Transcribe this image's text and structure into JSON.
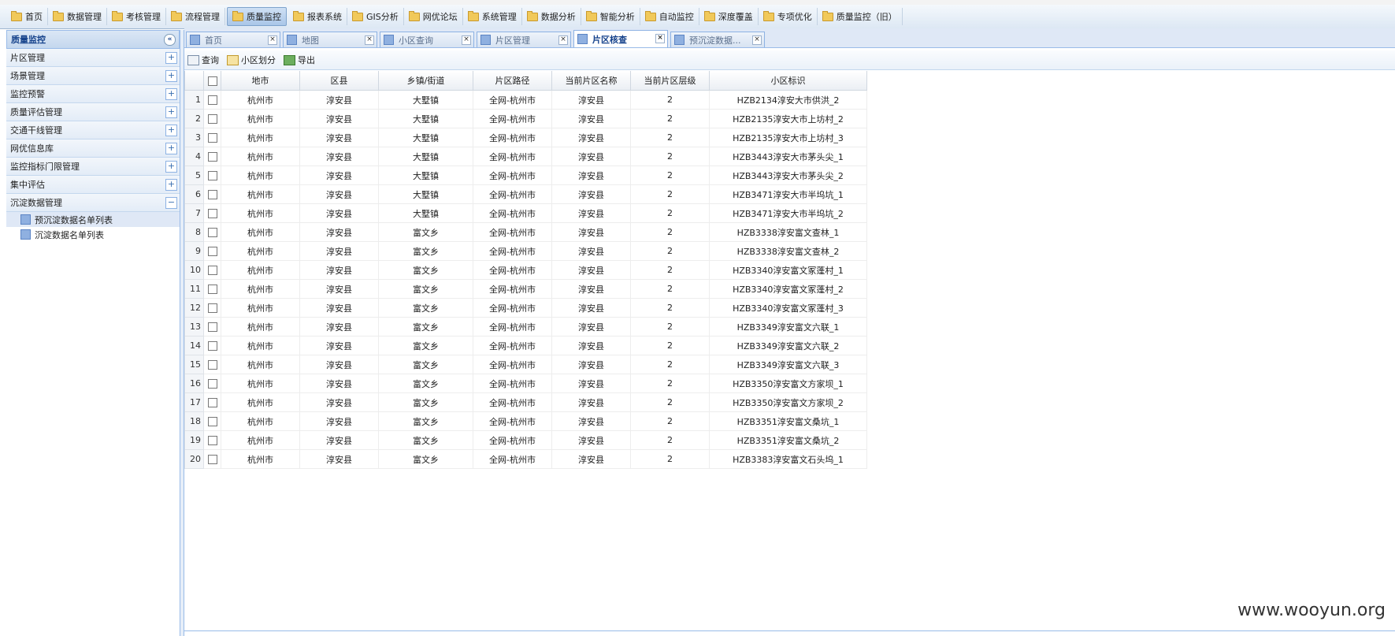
{
  "nav": {
    "items": [
      "首页",
      "数据管理",
      "考核管理",
      "流程管理",
      "质量监控",
      "报表系统",
      "GIS分析",
      "网优论坛",
      "系统管理",
      "数据分析",
      "智能分析",
      "自动监控",
      "深度覆盖",
      "专项优化",
      "质量监控（旧）"
    ],
    "active": "质量监控"
  },
  "sidebar": {
    "title": "质量监控",
    "sections": [
      "片区管理",
      "场景管理",
      "监控预警",
      "质量评估管理",
      "交通干线管理",
      "网优信息库",
      "监控指标门限管理",
      "集中评估",
      "沉淀数据管理"
    ],
    "expanded_section": "沉淀数据管理",
    "sub_items": [
      "预沉淀数据名单列表",
      "沉淀数据名单列表"
    ]
  },
  "tabs": [
    "首页",
    "地图",
    "小区查询",
    "片区管理",
    "片区核查",
    "预沉淀数据..."
  ],
  "active_tab": "片区核查",
  "toolbar": {
    "query": "查询",
    "divide": "小区划分",
    "export": "导出"
  },
  "grid": {
    "columns": [
      "地市",
      "区县",
      "乡镇/街道",
      "片区路径",
      "当前片区名称",
      "当前片区层级",
      "小区标识"
    ],
    "rows": [
      [
        "1",
        "杭州市",
        "淳安县",
        "大墅镇",
        "全网-杭州市",
        "淳安县",
        "2",
        "HZB2134淳安大市供洪_2"
      ],
      [
        "2",
        "杭州市",
        "淳安县",
        "大墅镇",
        "全网-杭州市",
        "淳安县",
        "2",
        "HZB2135淳安大市上坊村_2"
      ],
      [
        "3",
        "杭州市",
        "淳安县",
        "大墅镇",
        "全网-杭州市",
        "淳安县",
        "2",
        "HZB2135淳安大市上坊村_3"
      ],
      [
        "4",
        "杭州市",
        "淳安县",
        "大墅镇",
        "全网-杭州市",
        "淳安县",
        "2",
        "HZB3443淳安大市茅头尖_1"
      ],
      [
        "5",
        "杭州市",
        "淳安县",
        "大墅镇",
        "全网-杭州市",
        "淳安县",
        "2",
        "HZB3443淳安大市茅头尖_2"
      ],
      [
        "6",
        "杭州市",
        "淳安县",
        "大墅镇",
        "全网-杭州市",
        "淳安县",
        "2",
        "HZB3471淳安大市半坞坑_1"
      ],
      [
        "7",
        "杭州市",
        "淳安县",
        "大墅镇",
        "全网-杭州市",
        "淳安县",
        "2",
        "HZB3471淳安大市半坞坑_2"
      ],
      [
        "8",
        "杭州市",
        "淳安县",
        "富文乡",
        "全网-杭州市",
        "淳安县",
        "2",
        "HZB3338淳安富文查林_1"
      ],
      [
        "9",
        "杭州市",
        "淳安县",
        "富文乡",
        "全网-杭州市",
        "淳安县",
        "2",
        "HZB3338淳安富文查林_2"
      ],
      [
        "10",
        "杭州市",
        "淳安县",
        "富文乡",
        "全网-杭州市",
        "淳安县",
        "2",
        "HZB3340淳安富文冢蓬村_1"
      ],
      [
        "11",
        "杭州市",
        "淳安县",
        "富文乡",
        "全网-杭州市",
        "淳安县",
        "2",
        "HZB3340淳安富文冢蓬村_2"
      ],
      [
        "12",
        "杭州市",
        "淳安县",
        "富文乡",
        "全网-杭州市",
        "淳安县",
        "2",
        "HZB3340淳安富文冢蓬村_3"
      ],
      [
        "13",
        "杭州市",
        "淳安县",
        "富文乡",
        "全网-杭州市",
        "淳安县",
        "2",
        "HZB3349淳安富文六联_1"
      ],
      [
        "14",
        "杭州市",
        "淳安县",
        "富文乡",
        "全网-杭州市",
        "淳安县",
        "2",
        "HZB3349淳安富文六联_2"
      ],
      [
        "15",
        "杭州市",
        "淳安县",
        "富文乡",
        "全网-杭州市",
        "淳安县",
        "2",
        "HZB3349淳安富文六联_3"
      ],
      [
        "16",
        "杭州市",
        "淳安县",
        "富文乡",
        "全网-杭州市",
        "淳安县",
        "2",
        "HZB3350淳安富文方家坝_1"
      ],
      [
        "17",
        "杭州市",
        "淳安县",
        "富文乡",
        "全网-杭州市",
        "淳安县",
        "2",
        "HZB3350淳安富文方家坝_2"
      ],
      [
        "18",
        "杭州市",
        "淳安县",
        "富文乡",
        "全网-杭州市",
        "淳安县",
        "2",
        "HZB3351淳安富文桑坑_1"
      ],
      [
        "19",
        "杭州市",
        "淳安县",
        "富文乡",
        "全网-杭州市",
        "淳安县",
        "2",
        "HZB3351淳安富文桑坑_2"
      ],
      [
        "20",
        "杭州市",
        "淳安县",
        "富文乡",
        "全网-杭州市",
        "淳安县",
        "2",
        "HZB3383淳安富文石头坞_1"
      ]
    ]
  },
  "watermark": "www.wooyun.org"
}
